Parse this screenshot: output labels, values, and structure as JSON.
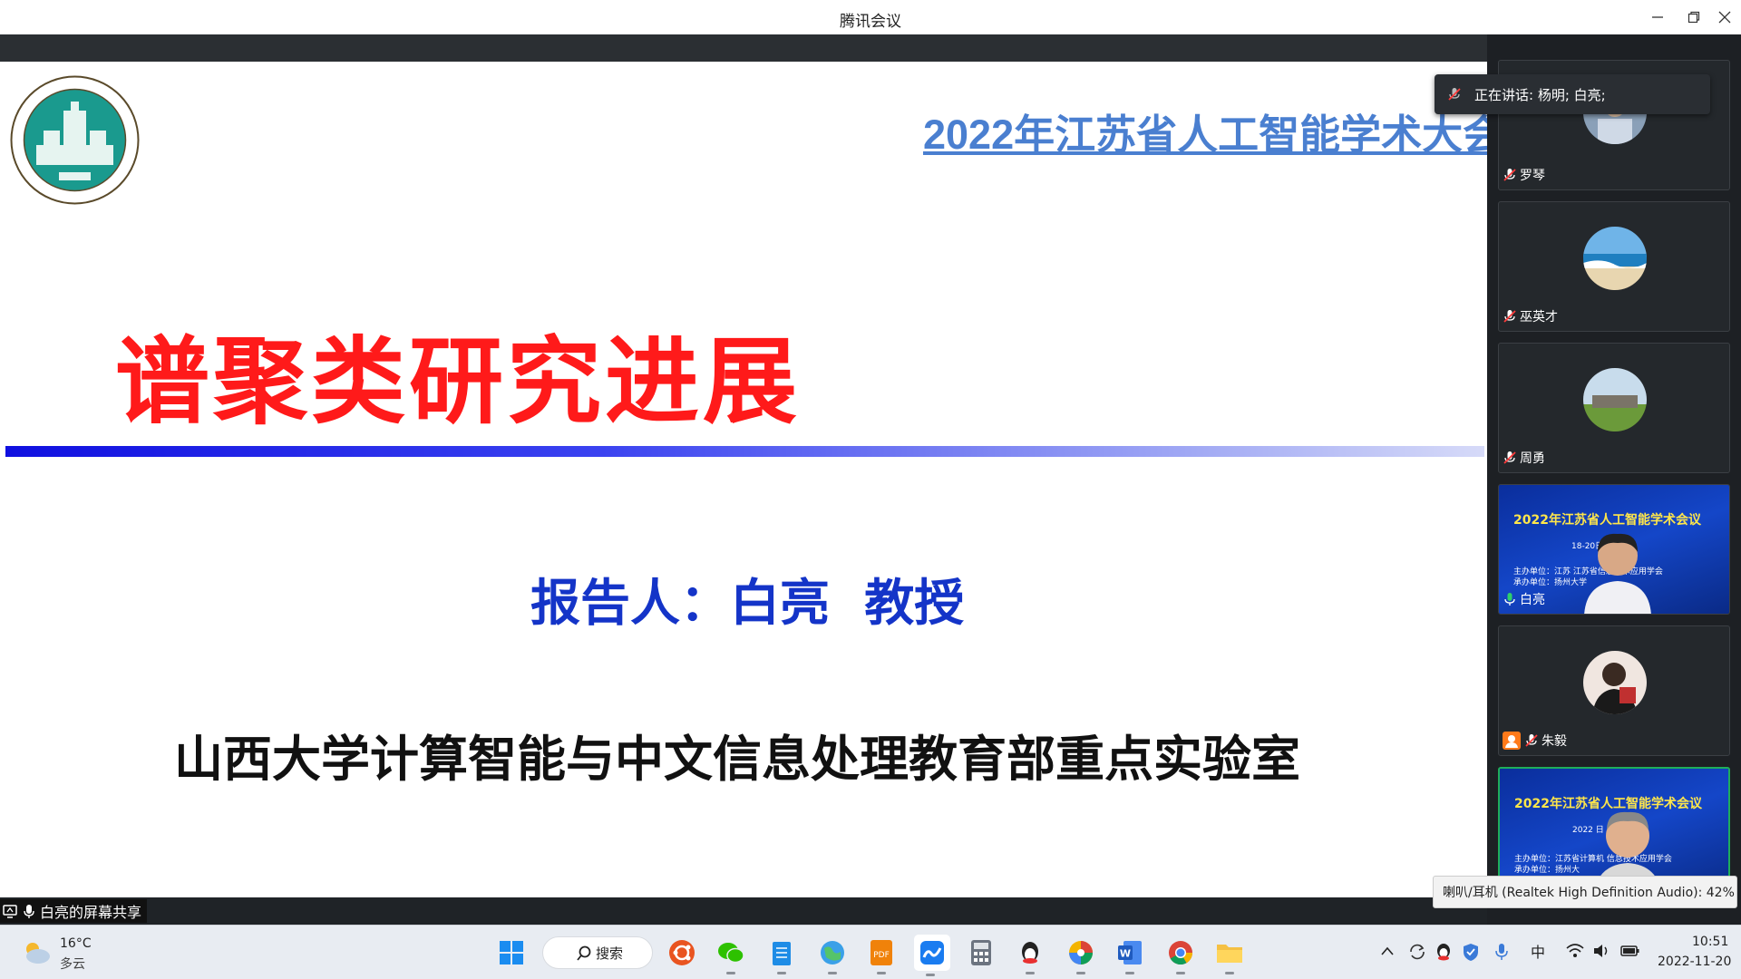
{
  "window": {
    "title": "腾讯会议"
  },
  "slide": {
    "header": "2022年江苏省人工智能学术大会",
    "logo_text": "山西大学 SHANXI UNIVERSITY CHINA 1902",
    "title": "谱聚类研究进展",
    "presenter": "报告人：白亮  教授",
    "lab": "山西大学计算智能与中文信息处理教育部重点实验室"
  },
  "share_bar": {
    "label": "白亮的屏幕共享"
  },
  "speaking": {
    "text": "正在讲话: 杨明; 白亮;"
  },
  "participants": [
    {
      "name": "罗琴",
      "muted": true
    },
    {
      "name": "巫英才",
      "muted": true
    },
    {
      "name": "周勇",
      "muted": true
    },
    {
      "name": "白亮",
      "muted": false,
      "video_title": "2022年江苏省人工智能学术会议",
      "video_line2": "18-20日",
      "video_line3": "主办单位：江苏   江苏省信息技术应用学会",
      "video_line4": "承办单位：扬州大学"
    },
    {
      "name": "朱毅",
      "muted": true
    },
    {
      "name": "",
      "muted": false,
      "video_title": "2022年江苏省人工智能学术会议",
      "video_line2": "2022       日",
      "video_line3": "主办单位：江苏省计算机   信息技术应用学会",
      "video_line4": "承办单位：扬州大"
    }
  ],
  "volume_tooltip": "喇叭/耳机 (Realtek High Definition Audio): 42%",
  "taskbar": {
    "weather_temp": "16°C",
    "weather_desc": "多云",
    "search_label": "搜索",
    "ime": "中",
    "time": "10:51",
    "date": "2022-11-20"
  },
  "colors": {
    "slide_title": "#ff1a1a",
    "slide_header": "#4a7fd0",
    "presenter": "#1434c8",
    "active_speaker_border": "#1fae5b",
    "panel_bg": "#1d2024"
  }
}
